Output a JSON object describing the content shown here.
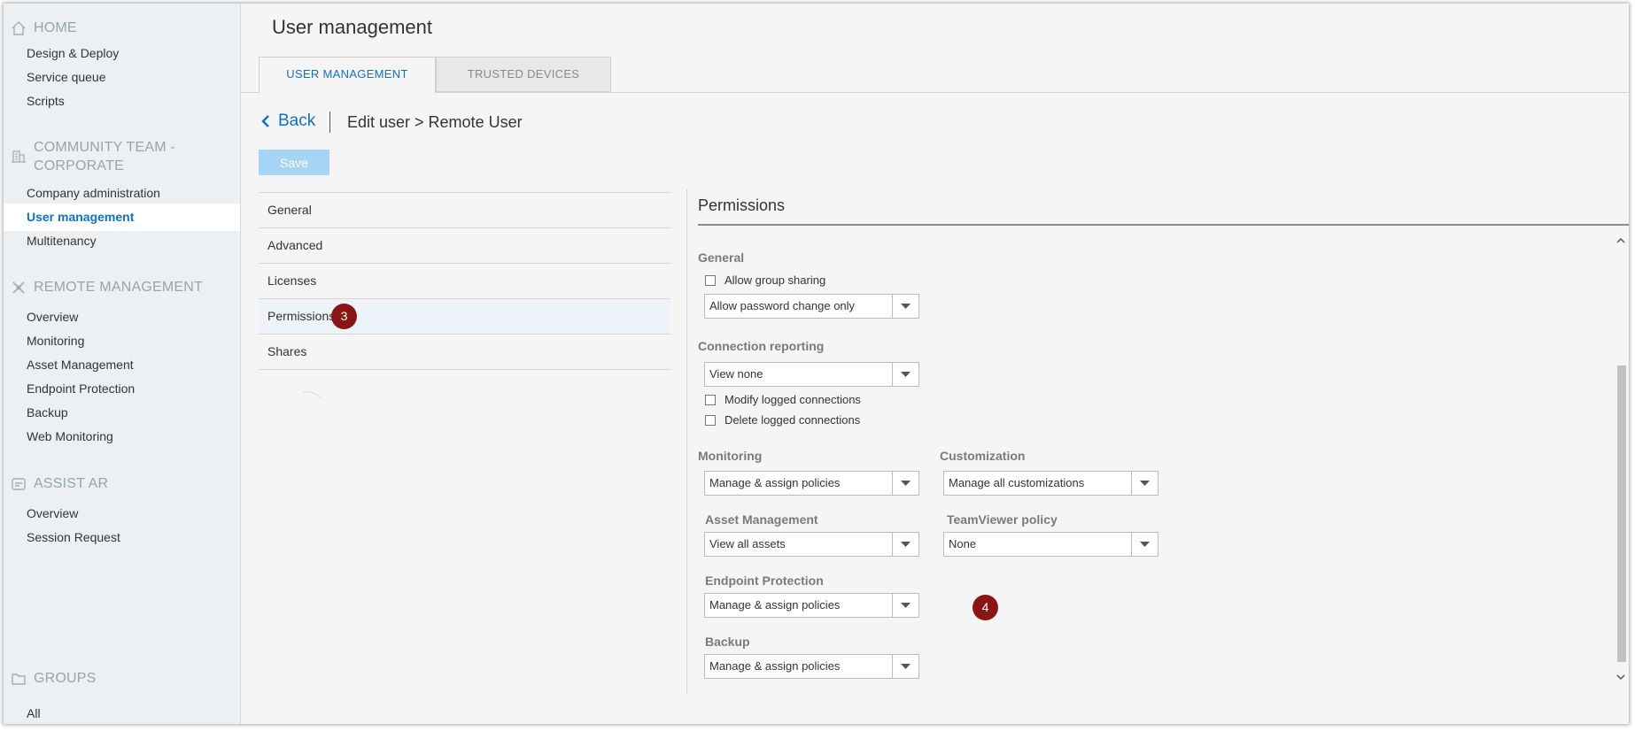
{
  "sidebar": {
    "home": {
      "title": "HOME",
      "items": [
        {
          "label": "Design & Deploy"
        },
        {
          "label": "Service queue"
        },
        {
          "label": "Scripts"
        }
      ]
    },
    "company": {
      "title_line1": "COMMUNITY TEAM -",
      "title_line2": "CORPORATE",
      "items": [
        {
          "label": "Company administration"
        },
        {
          "label": "User management",
          "active": true
        },
        {
          "label": "Multitenancy"
        }
      ]
    },
    "remote": {
      "title": "REMOTE MANAGEMENT",
      "items": [
        {
          "label": "Overview"
        },
        {
          "label": "Monitoring"
        },
        {
          "label": "Asset Management"
        },
        {
          "label": "Endpoint Protection"
        },
        {
          "label": "Backup"
        },
        {
          "label": "Web Monitoring"
        }
      ]
    },
    "assist": {
      "title": "ASSIST AR",
      "items": [
        {
          "label": "Overview"
        },
        {
          "label": "Session Request"
        }
      ]
    },
    "groups": {
      "title": "GROUPS",
      "items": [
        {
          "label": "All"
        }
      ]
    }
  },
  "header": {
    "title": "User management",
    "tabs": [
      {
        "label": "USER MANAGEMENT",
        "active": true
      },
      {
        "label": "TRUSTED DEVICES",
        "active": false
      }
    ]
  },
  "breadcrumb": {
    "back_label": "Back",
    "text": "Edit user > Remote User"
  },
  "actions": {
    "save_label": "Save"
  },
  "menu": {
    "items": [
      {
        "label": "General"
      },
      {
        "label": "Advanced"
      },
      {
        "label": "Licenses"
      },
      {
        "label": "Permissions",
        "active": true
      },
      {
        "label": "Shares"
      }
    ]
  },
  "callouts": {
    "menu_badge": "3",
    "panel_badge": "4"
  },
  "permissions": {
    "title": "Permissions",
    "general": {
      "label": "General",
      "allow_group_sharing": "Allow group sharing",
      "password_select": "Allow password change only"
    },
    "connection_reporting": {
      "label": "Connection reporting",
      "select": "View none",
      "modify": "Modify logged connections",
      "delete": "Delete logged connections"
    },
    "monitoring": {
      "label": "Monitoring",
      "select": "Manage & assign policies"
    },
    "customization": {
      "label": "Customization",
      "select": "Manage all customizations"
    },
    "asset_management": {
      "label": "Asset Management",
      "select": "View all assets"
    },
    "teamviewer_policy": {
      "label": "TeamViewer policy",
      "select": "None"
    },
    "endpoint_protection": {
      "label": "Endpoint Protection",
      "select": "Manage & assign policies"
    },
    "backup": {
      "label": "Backup",
      "select": "Manage & assign policies"
    }
  },
  "colors": {
    "accent": "#1170c1",
    "badge": "#8b1414",
    "save_disabled": "#a6d4f5",
    "sidebar_bg": "#edf0f3"
  }
}
